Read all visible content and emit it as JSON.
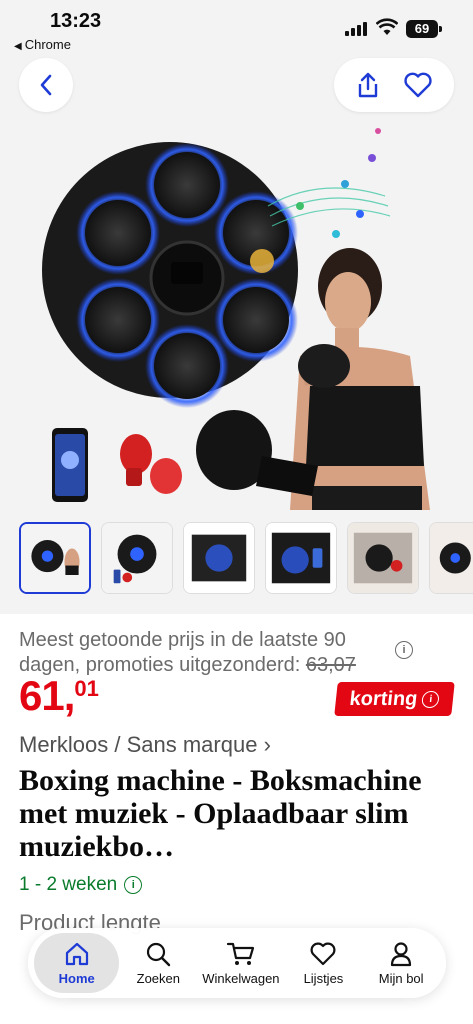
{
  "status_bar": {
    "time": "13:23",
    "back_app": "Chrome",
    "battery": "69"
  },
  "colors": {
    "accent_blue": "#1f3bd6",
    "price_red": "#e30613",
    "delivery_green": "#0a7b2c"
  },
  "header": {
    "back_icon": "chevron-left-icon",
    "share_icon": "share-icon",
    "wishlist_icon": "heart-icon"
  },
  "gallery": {
    "selected_index": 0,
    "thumbnail_count": 6
  },
  "product": {
    "lowest_price_note": "Meest getoonde prijs in de laatste 90 dagen, promoties uitgezonderd:",
    "old_price": "63,07",
    "price_euros": "61,",
    "price_cents": "01",
    "badge": "korting",
    "brand": "Merkloos / Sans marque",
    "brand_chevron": "›",
    "title": "Boxing machine - Boksmachine met muziek - Oplaadbaar slim muziekbo…",
    "delivery": "1 - 2 weken",
    "spec_label": "Product lengte"
  },
  "bottom_nav": {
    "items": [
      {
        "label": "Home",
        "icon": "home-icon"
      },
      {
        "label": "Zoeken",
        "icon": "search-icon"
      },
      {
        "label": "Winkelwagen",
        "icon": "cart-icon"
      },
      {
        "label": "Lijstjes",
        "icon": "heart-icon"
      },
      {
        "label": "Mijn bol",
        "icon": "user-icon"
      }
    ]
  }
}
